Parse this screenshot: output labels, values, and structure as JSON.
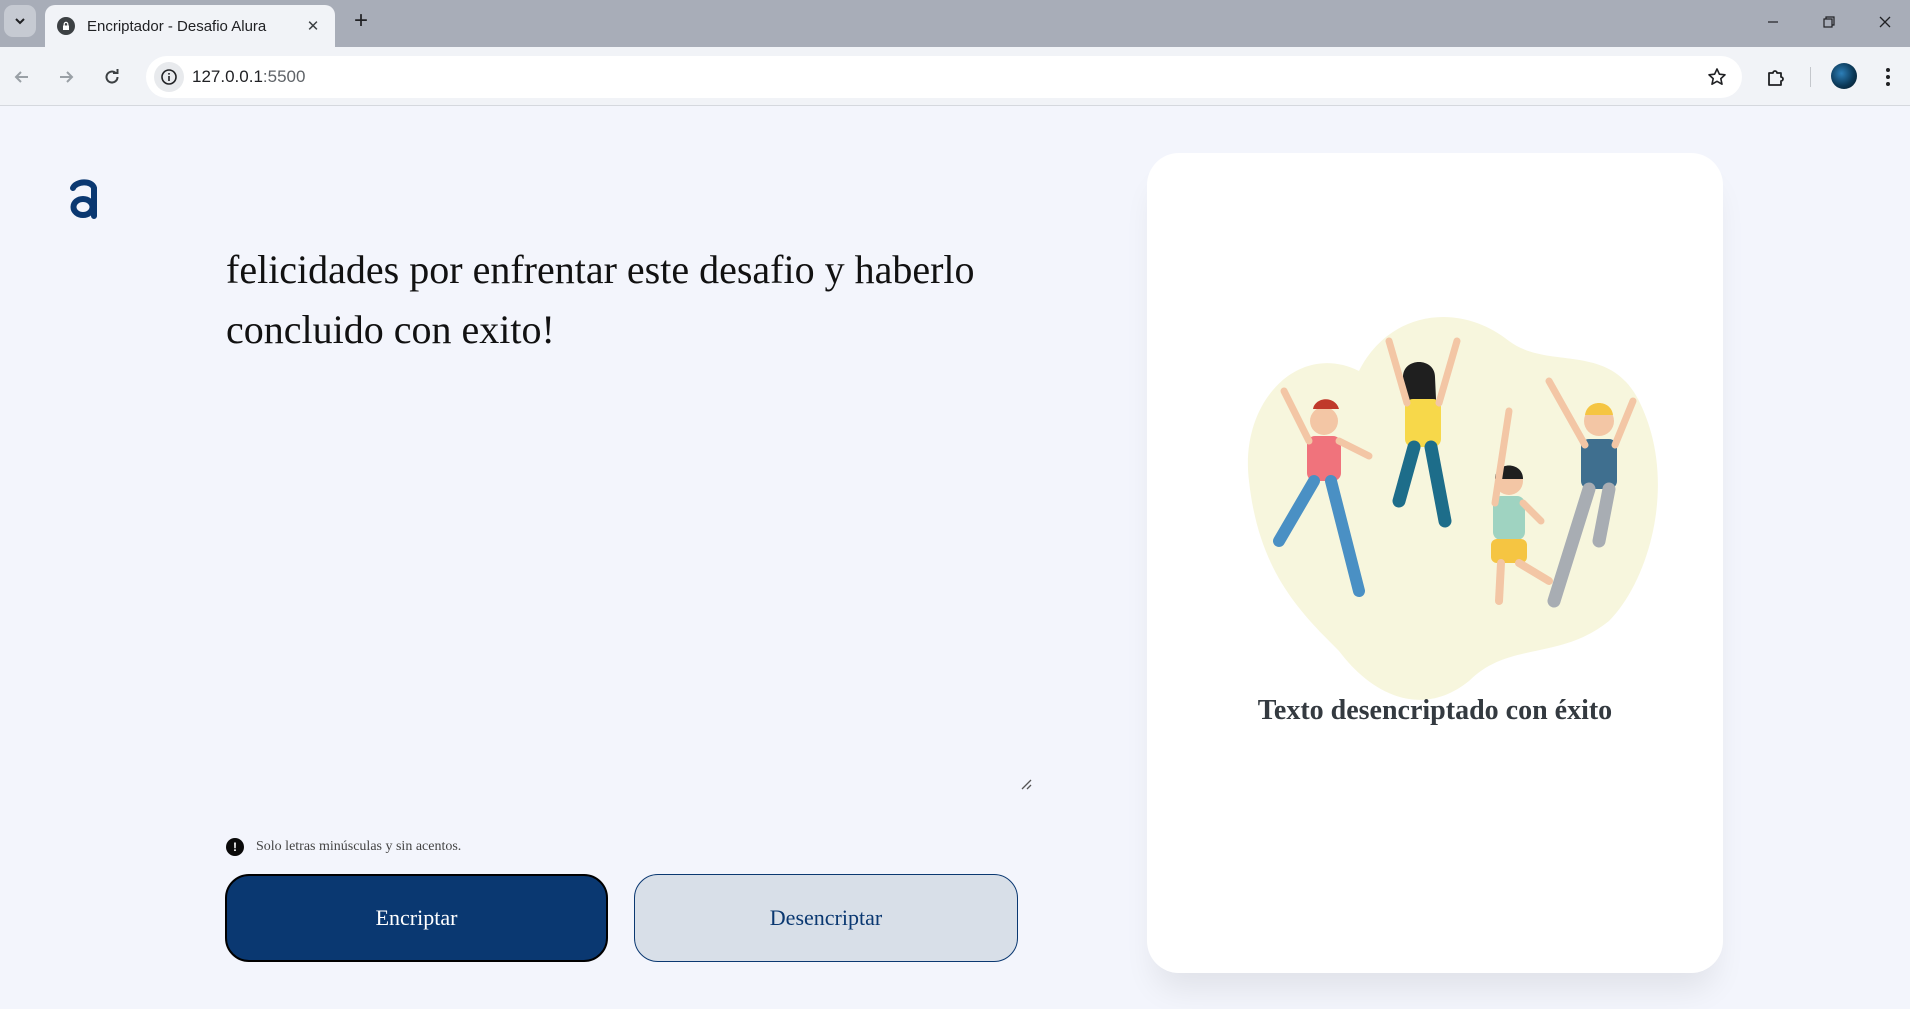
{
  "browser": {
    "tab_title": "Encriptador - Desafio Alura",
    "url_host": "127.0.0.1",
    "url_port": ":5500"
  },
  "page": {
    "message": "felicidades por enfrentar este desafio y haberlo concluido con exito!",
    "hint": "Solo letras minúsculas y sin acentos.",
    "encrypt_label": "Encriptar",
    "decrypt_label": "Desencriptar",
    "result_title": "Texto desencriptado con éxito",
    "accent_color": "#0a3871"
  }
}
